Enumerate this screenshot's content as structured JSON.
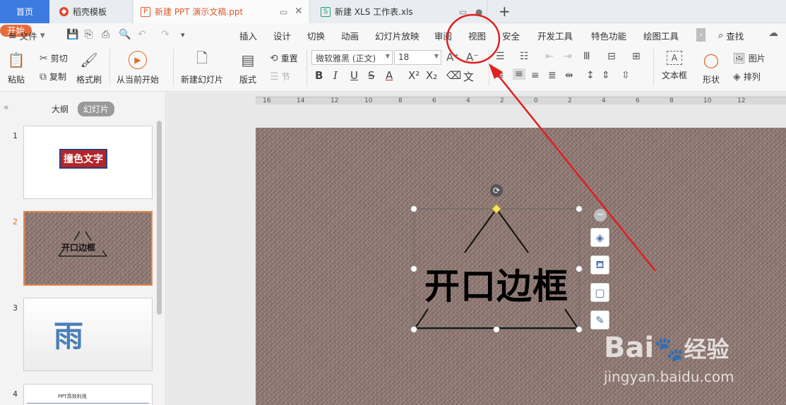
{
  "tabs": {
    "home": "首页",
    "templates": "稻壳模板",
    "ppt": "新建 PPT 演示文稿.ppt",
    "xls": "新建 XLS 工作表.xls",
    "add": "+"
  },
  "menu": {
    "file": "文件",
    "items": [
      "开始",
      "插入",
      "设计",
      "切换",
      "动画",
      "幻灯片放映",
      "审阅",
      "视图",
      "安全",
      "开发工具",
      "特色功能",
      "绘图工具"
    ],
    "search": "查找"
  },
  "ribbon": {
    "paste": "粘贴",
    "cut": "剪切",
    "copy": "复制",
    "format_painter": "格式刷",
    "from_current": "从当前开始",
    "new_slide": "新建幻灯片",
    "layout": "版式",
    "reset": "重置",
    "section": "节",
    "font_name": "微软雅黑 (正文)",
    "font_size": "18",
    "textbox": "文本框",
    "shape": "形状",
    "picture": "图片",
    "arrange": "排列"
  },
  "panel": {
    "outline_tab": "大纲",
    "slides_tab": "幻灯片",
    "thumbs": [
      {
        "num": "1",
        "text": "撞色文字"
      },
      {
        "num": "2",
        "text": "开口边框"
      },
      {
        "num": "3",
        "text": "雨"
      },
      {
        "num": "4",
        "text": "PPT高效利用"
      }
    ]
  },
  "ruler": [
    "16",
    "14",
    "12",
    "10",
    "8",
    "6",
    "4",
    "2",
    "0",
    "2",
    "4",
    "6",
    "8",
    "10",
    "12"
  ],
  "slide": {
    "title_text": "开口边框"
  },
  "watermark": {
    "brand": "Bai",
    "brand2": "经验",
    "url": "jingyan.baidu.com"
  },
  "colors": {
    "accent_orange": "#e66b3c",
    "home_blue": "#3d7be0",
    "annotation_red": "#e02020"
  }
}
